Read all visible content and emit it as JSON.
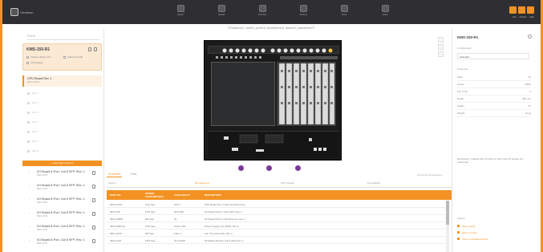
{
  "app": {
    "logo_text": "Omnitron"
  },
  "toolbar": {
    "items": [
      {
        "label": "Export",
        "icon": "export-icon"
      },
      {
        "label": "Upload",
        "icon": "upload-icon"
      },
      {
        "label": "Overview",
        "icon": "overview-icon"
      },
      {
        "label": "Settings",
        "icon": "settings-icon"
      },
      {
        "label": "Close",
        "icon": "close-icon"
      },
      {
        "label": "Notes",
        "icon": "notes-icon"
      }
    ],
    "right_labels": [
      "Cart",
      "Account",
      "Login"
    ]
  },
  "breadcrumb": "OPU/pmm/U2_Card/U1_pmm/U2_Board/pmm/U1_Board/U1_Board/pmm/TT",
  "left": {
    "search_placeholder": "Search",
    "device": {
      "title": "KMS-150-R1",
      "opt1": "Include Hidden Info",
      "opt2": "Shared Config",
      "opt3": "Full Display"
    },
    "selected": {
      "title": "CPU Board Rev 1",
      "sub": "MFG-CPU-1"
    },
    "slots": [
      "Slot 2",
      "Slot 3",
      "Slot 4",
      "Slot 5",
      "Slot 6",
      "Slot 7",
      "Slot 8"
    ],
    "add_label": "+ Add Card to Slot 9",
    "boards": [
      {
        "title": "I/O Board 8-Port, Cat 5 SFP, Rev. 1",
        "sub": "MFG-IO8"
      },
      {
        "title": "I/O Board 8-Port, Cat 5 SFP, Rev. 1",
        "sub": "MFG-IO8"
      },
      {
        "title": "I/O Board 8-Port, Cat 5 SFP, Rev. 1",
        "sub": "MFG-IO8"
      },
      {
        "title": "I/O Board 8-Port, Cat 5 SFP, Rev. 1",
        "sub": "MFG-IO8"
      },
      {
        "title": "I/O Board 8-Port, Cat 5 SFP, Rev. 1",
        "sub": "MFG-IO8"
      },
      {
        "title": "I/O Board 8-Port, Cat 5 SFP, Rev. 1",
        "sub": "MFG-IO8"
      },
      {
        "title": "I/O Board 8-Port, Cat 5 SFP, Rev. 1",
        "sub": "MFG-IO8"
      }
    ]
  },
  "center": {
    "tabs": [
      "Properties",
      "Ports"
    ],
    "right_link": "Download Spreadsheet",
    "filters": [
      "Search",
      "All Categories",
      "CPU Models",
      "Compatibility"
    ],
    "columns": [
      "PART NO.",
      "POWER CONSUMPTION",
      "AVAILABILITY",
      "DESCRIPTION"
    ],
    "rows": [
      [
        "MFG-CPU1",
        "11W Sea",
        "CPU 1",
        "CPU Board Rev 1 with Intel Dual Core"
      ],
      [
        "MFG-IO8",
        "12W Sea",
        "IO-8 SFP",
        "I/O Board 8-Port, Cat 5 SFP, Rev 1"
      ],
      [
        "MFG-IO8FE",
        "8W Sea",
        "IO",
        "I/O Board 8-Port, Fast Ethernet, Rev 1"
      ],
      [
        "MFG-PWR-A1",
        "15W Sea",
        "Power 150",
        "Power Supply Unit 150W, Rev A"
      ],
      [
        "MFG-FAN1",
        "4W Sea",
        "Fans 1",
        "Fan Tray Assembly, Rev 1"
      ],
      [
        "MFG-IO16",
        "14W Sea",
        "IO-16 SFP",
        "I/O Board 16-Port, Cat 5 SFP, Rev 1"
      ]
    ]
  },
  "right": {
    "title": "KMS-150-R1",
    "section1": "Configuration",
    "field": "Standard",
    "section2": "Properties",
    "props": [
      [
        "Slots",
        "10"
      ],
      [
        "Power",
        "150W"
      ],
      [
        "Fan Units",
        "2"
      ],
      [
        "Depth",
        "485 mm"
      ],
      [
        "Height",
        "4U"
      ],
      [
        "Weight",
        "12 kg"
      ]
    ],
    "note": "Description: Chassis with 10 slots for CPU and I/O boards, 4U rackmount.",
    "section3": "Actions",
    "links": [
      "Save Config",
      "Export Config",
      "View Compatible Boards"
    ]
  }
}
